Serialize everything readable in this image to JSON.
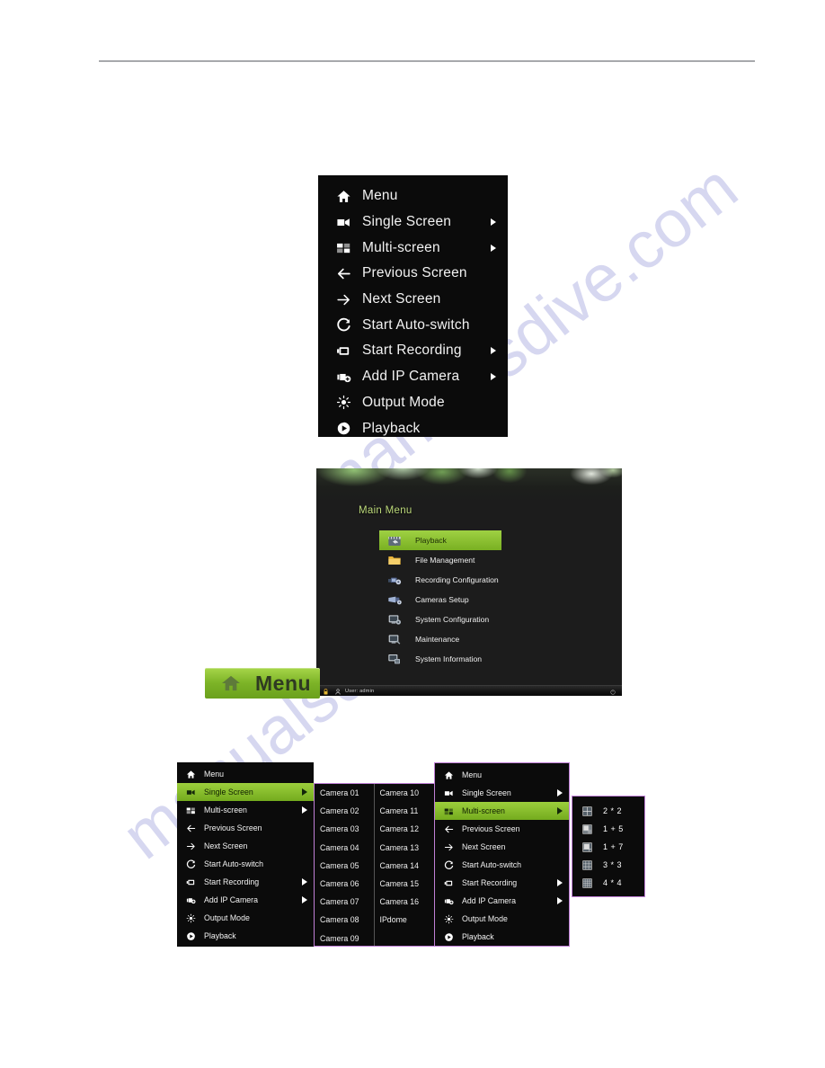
{
  "watermark": {
    "line1": "manualsdive.com",
    "line2": "manualsdive.com"
  },
  "context_menu": {
    "items": [
      {
        "label": "Menu",
        "icon": "home-icon",
        "arrow": false
      },
      {
        "label": "Single Screen",
        "icon": "single-screen-icon",
        "arrow": true
      },
      {
        "label": "Multi-screen",
        "icon": "multi-screen-icon",
        "arrow": true
      },
      {
        "label": "Previous Screen",
        "icon": "arrow-left-icon",
        "arrow": false
      },
      {
        "label": "Next Screen",
        "icon": "arrow-right-icon",
        "arrow": false
      },
      {
        "label": "Start Auto-switch",
        "icon": "refresh-icon",
        "arrow": false
      },
      {
        "label": "Start Recording",
        "icon": "record-icon",
        "arrow": true
      },
      {
        "label": "Add IP Camera",
        "icon": "add-camera-icon",
        "arrow": true
      },
      {
        "label": "Output Mode",
        "icon": "brightness-icon",
        "arrow": false
      },
      {
        "label": "Playback",
        "icon": "playback-icon",
        "arrow": false
      }
    ]
  },
  "main_menu_window": {
    "title": "Main Menu",
    "items": [
      {
        "label": "Playback",
        "icon": "playback-clapper-icon",
        "selected": true
      },
      {
        "label": "File Management",
        "icon": "folder-icon",
        "selected": false
      },
      {
        "label": "Recording Configuration",
        "icon": "recording-config-icon",
        "selected": false
      },
      {
        "label": "Cameras Setup",
        "icon": "camera-setup-icon",
        "selected": false
      },
      {
        "label": "System Configuration",
        "icon": "system-config-icon",
        "selected": false
      },
      {
        "label": "Maintenance",
        "icon": "maintenance-icon",
        "selected": false
      },
      {
        "label": "System Information",
        "icon": "system-info-icon",
        "selected": false
      }
    ],
    "status_bar": {
      "lock_icon": "lock-icon",
      "user_icon": "user-icon",
      "user_text": "User: admin",
      "right_icon": "power-icon"
    }
  },
  "menu_button": {
    "label": "Menu",
    "icon": "home-icon"
  },
  "menu_bottom_left": {
    "selected_index": 1
  },
  "menu_bottom_right": {
    "selected_index": 2
  },
  "camera_list": {
    "column_left": [
      "Camera 01",
      "Camera 02",
      "Camera 03",
      "Camera 04",
      "Camera 05",
      "Camera 06",
      "Camera 07",
      "Camera 08",
      "Camera 09"
    ],
    "column_right": [
      "Camera 10",
      "Camera 11",
      "Camera 12",
      "Camera 13",
      "Camera 14",
      "Camera 15",
      "Camera 16",
      "IPdome"
    ]
  },
  "layout_submenu": {
    "items": [
      {
        "label": "2 * 2",
        "icon": "grid-2x2-icon"
      },
      {
        "label": "1 + 5",
        "icon": "grid-1plus5-icon"
      },
      {
        "label": "1 + 7",
        "icon": "grid-1plus7-icon"
      },
      {
        "label": "3 * 3",
        "icon": "grid-3x3-icon"
      },
      {
        "label": "4 * 4",
        "icon": "grid-4x4-icon"
      }
    ]
  },
  "colors": {
    "accent_green": "#7db427",
    "panel_black": "#0b0b0b",
    "border_purple": "#c07fd6",
    "title_green": "#bcd97a",
    "watermark": "#d6d7f0"
  }
}
